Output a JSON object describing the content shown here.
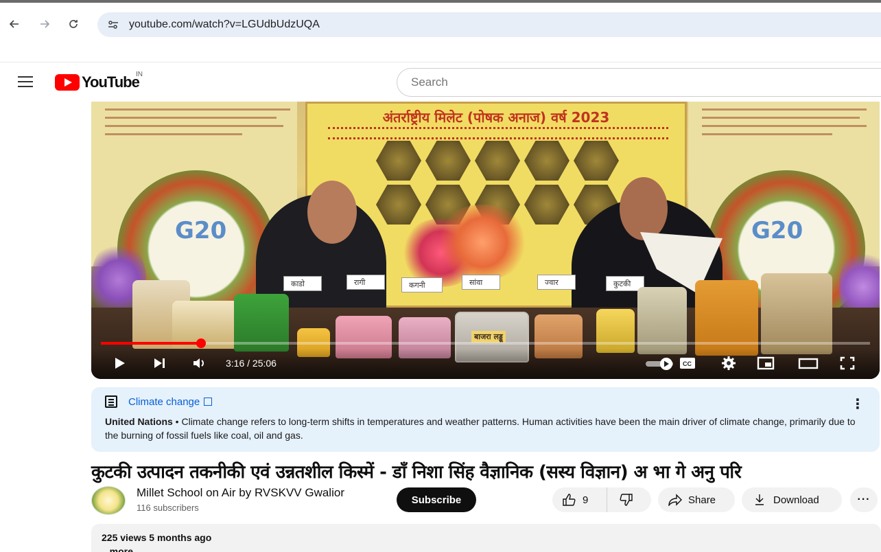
{
  "browser": {
    "url": "youtube.com/watch?v=LGUdbUdzUQA",
    "back_icon": "arrow-left-icon",
    "forward_icon": "arrow-right-icon",
    "reload_icon": "reload-icon",
    "site_settings_icon": "tune-icon"
  },
  "header": {
    "logo_text": "YouTube",
    "country_code": "IN",
    "search_placeholder": "Search"
  },
  "player": {
    "banner_title": "अंतर्राष्ट्रीय मिलेट (पोषक अनाज) वर्ष 2023",
    "g20_label": "G20",
    "time_display": "3:16 / 25:06",
    "progress_fraction": 0.13,
    "product_label": "बाजरा लड्डू",
    "flags": [
      "काडो",
      "रागी",
      "कगनी",
      "सांवा",
      "ज्वार",
      "कुटकी"
    ]
  },
  "info_panel": {
    "title": "Climate change",
    "source": "United Nations",
    "separator": " • ",
    "text": "Climate change refers to long-term shifts in temperatures and weather patterns. Human activities have been the main driver of climate change, primarily due to the burning of fossil fuels like coal, oil and gas."
  },
  "video": {
    "title": "कुटकी उत्पादन तकनीकी एवं उन्नतशील किस्में - डाँ निशा सिंह वैज्ञानिक (सस्य विज्ञान) अ भा गे अनु परि"
  },
  "channel": {
    "name": "Millet School on Air by RVSKVV Gwalior",
    "subscribers": "116 subscribers",
    "subscribe_label": "Subscribe"
  },
  "actions": {
    "like_count": "9",
    "share_label": "Share",
    "download_label": "Download",
    "more_label": "···"
  },
  "description": {
    "meta": "225 views  5 months ago",
    "more_label": "...more"
  }
}
